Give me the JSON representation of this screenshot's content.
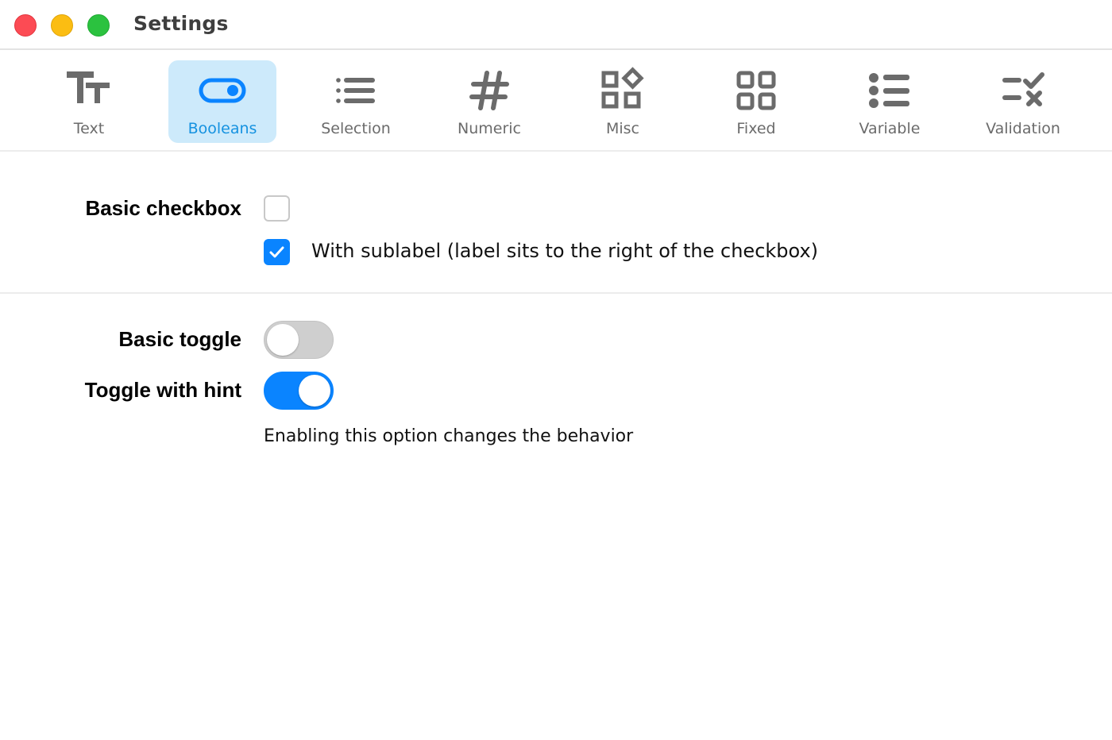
{
  "window": {
    "title": "Settings"
  },
  "toolbar": {
    "tabs": [
      {
        "label": "Text",
        "icon": "text-size-icon",
        "active": false
      },
      {
        "label": "Booleans",
        "icon": "toggle-icon",
        "active": true
      },
      {
        "label": "Selection",
        "icon": "list-icon",
        "active": false
      },
      {
        "label": "Numeric",
        "icon": "hash-icon",
        "active": false
      },
      {
        "label": "Misc",
        "icon": "shapes-icon",
        "active": false
      },
      {
        "label": "Fixed",
        "icon": "grid-icon",
        "active": false
      },
      {
        "label": "Variable",
        "icon": "bullet-list-icon",
        "active": false
      },
      {
        "label": "Validation",
        "icon": "validation-icon",
        "active": false
      }
    ]
  },
  "checkbox_section": {
    "label": "Basic checkbox",
    "basic_checked": false,
    "sublabel_checked": true,
    "sublabel": "With sublabel (label sits to the right of the checkbox)"
  },
  "toggle_section": {
    "basic_label": "Basic toggle",
    "basic_on": false,
    "hint_label": "Toggle with hint",
    "hint_on": true,
    "hint_text": "Enabling this option changes the behavior"
  },
  "colors": {
    "accent": "#0a84ff",
    "active_tab_bg": "#cdeafb",
    "active_tab_text": "#1592e0",
    "icon_gray": "#6b6b6b",
    "close": "#fc4b54",
    "minimize": "#fbbd12",
    "maximize": "#2bc23f"
  }
}
